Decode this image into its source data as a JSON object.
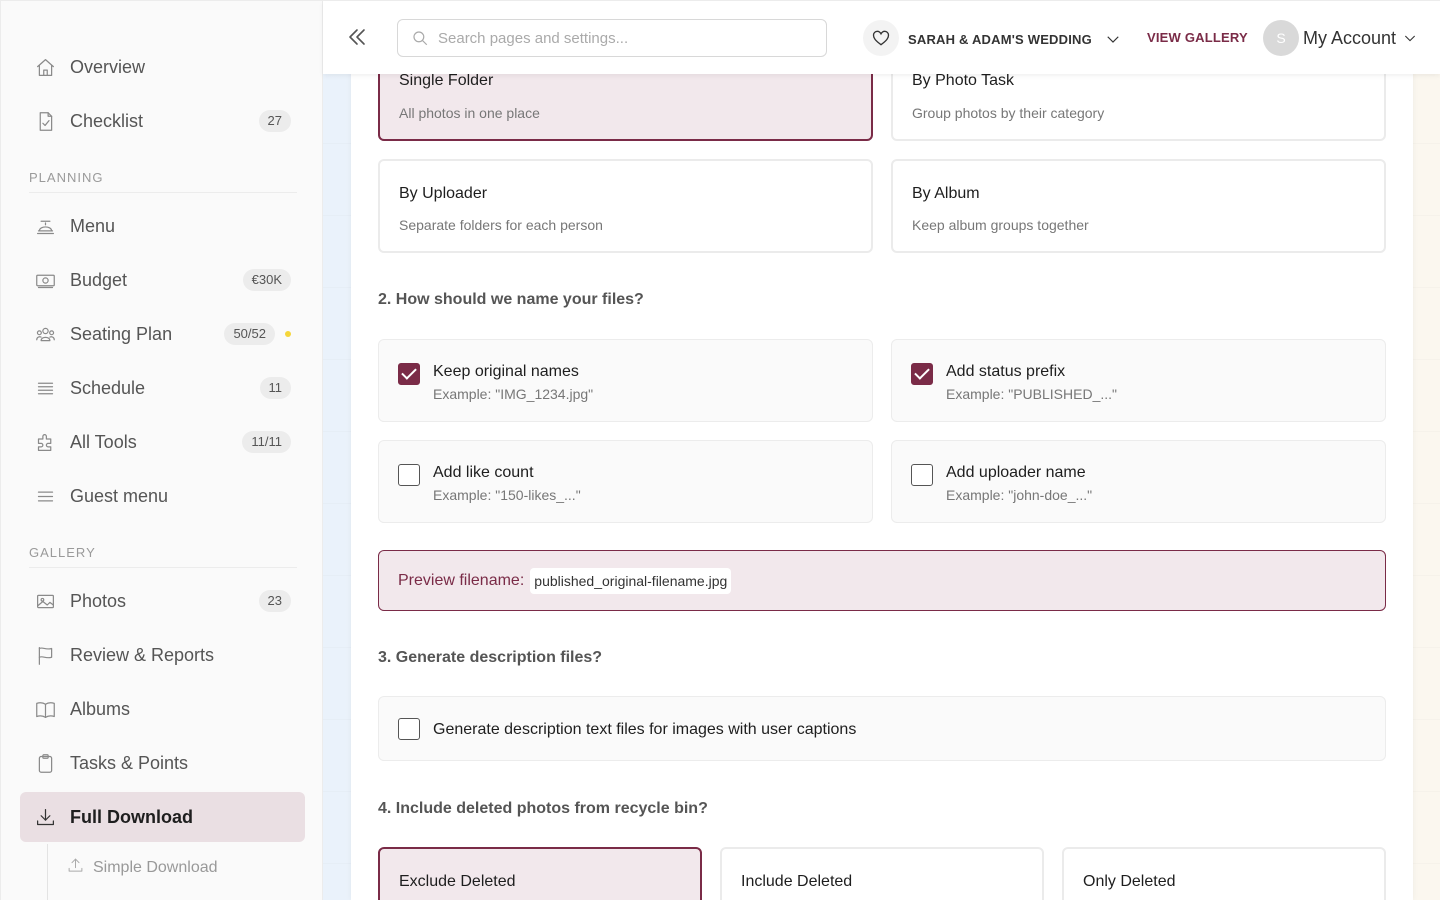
{
  "sidebar": {
    "items": [
      {
        "label": "Overview",
        "badge": ""
      },
      {
        "label": "Checklist",
        "badge": "27"
      },
      {
        "label": "Menu",
        "badge": ""
      },
      {
        "label": "Budget",
        "badge": "€30K"
      },
      {
        "label": "Seating Plan",
        "badge": "50/52"
      },
      {
        "label": "Schedule",
        "badge": "11"
      },
      {
        "label": "All Tools",
        "badge": "11/11"
      },
      {
        "label": "Guest menu",
        "badge": ""
      },
      {
        "label": "Photos",
        "badge": "23"
      },
      {
        "label": "Review & Reports",
        "badge": ""
      },
      {
        "label": "Albums",
        "badge": ""
      },
      {
        "label": "Tasks & Points",
        "badge": ""
      },
      {
        "label": "Full Download",
        "badge": ""
      }
    ],
    "sections": {
      "planning": "PLANNING",
      "gallery": "GALLERY"
    },
    "sub_items": [
      {
        "label": "Simple Download"
      }
    ]
  },
  "topbar": {
    "search_placeholder": "Search pages and settings...",
    "event_name": "SARAH & ADAM'S WEDDING",
    "view_gallery": "VIEW GALLERY",
    "avatar_initial": "S",
    "account_label": "My Account"
  },
  "folder_options": [
    {
      "title": "Single Folder",
      "sub": "All photos in one place",
      "selected": true
    },
    {
      "title": "By Photo Task",
      "sub": "Group photos by their category",
      "selected": false
    },
    {
      "title": "By Uploader",
      "sub": "Separate folders for each person",
      "selected": false
    },
    {
      "title": "By Album",
      "sub": "Keep album groups together",
      "selected": false
    }
  ],
  "questions": {
    "q2": "2. How should we name your files?",
    "q3": "3. Generate description files?",
    "q4": "4. Include deleted photos from recycle bin?"
  },
  "naming_options": [
    {
      "title": "Keep original names",
      "example": "Example: \"IMG_1234.jpg\"",
      "checked": true
    },
    {
      "title": "Add status prefix",
      "example": "Example: \"PUBLISHED_...\"",
      "checked": true
    },
    {
      "title": "Add like count",
      "example": "Example: \"150-likes_...\"",
      "checked": false
    },
    {
      "title": "Add uploader name",
      "example": "Example: \"john-doe_...\"",
      "checked": false
    }
  ],
  "preview": {
    "label": "Preview filename:",
    "value": "published_original-filename.jpg"
  },
  "description_option": {
    "title": "Generate description text files for images with user captions",
    "checked": false
  },
  "deleted_options": [
    {
      "title": "Exclude Deleted",
      "selected": true
    },
    {
      "title": "Include Deleted",
      "selected": false
    },
    {
      "title": "Only Deleted",
      "selected": false
    }
  ],
  "colors": {
    "accent": "#7a2b47",
    "selected_bg": "#f2e8ec",
    "badge_dot": "#f5d63a"
  },
  "icons": [
    "home-icon",
    "checklist-icon",
    "menu-food-icon",
    "budget-icon",
    "seating-icon",
    "schedule-icon",
    "tools-icon",
    "guest-menu-icon",
    "photos-icon",
    "flag-icon",
    "albums-icon",
    "clipboard-icon",
    "download-icon",
    "upload-icon",
    "search-icon",
    "heart-icon",
    "chevron-down-icon",
    "double-chevron-left-icon"
  ]
}
